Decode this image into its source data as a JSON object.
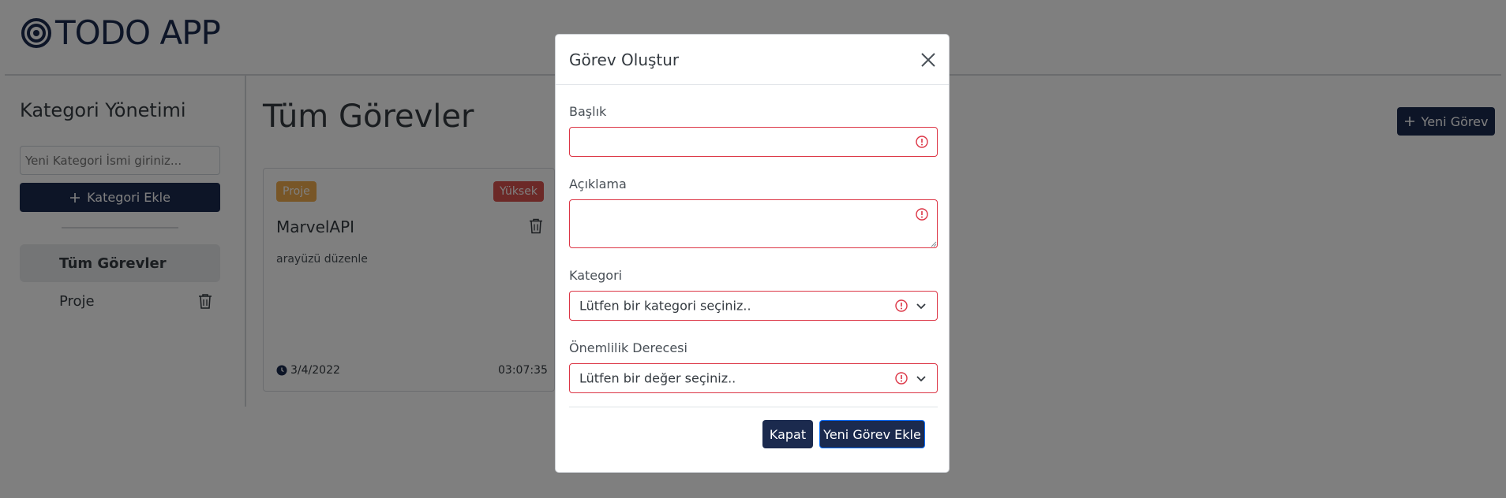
{
  "app": {
    "logo_text": "TODO APP"
  },
  "sidebar": {
    "title": "Kategori Yönetimi",
    "category_input_placeholder": "Yeni Kategori İsmi giriniz...",
    "add_category_label": "Kategori Ekle",
    "items": [
      {
        "label": "Tüm Görevler"
      },
      {
        "label": "Proje"
      }
    ]
  },
  "main": {
    "title": "Tüm Görevler",
    "new_task_label": "Yeni Görev",
    "card": {
      "category_badge": "Proje",
      "priority_badge": "Yüksek",
      "title": "MarvelAPI",
      "description": "arayüzü düzenle",
      "date": "3/4/2022",
      "time": "03:07:35"
    }
  },
  "modal": {
    "title": "Görev Oluştur",
    "title_label": "Başlık",
    "description_label": "Açıklama",
    "category_label": "Kategori",
    "category_placeholder": "Lütfen bir kategori seçiniz..",
    "priority_label": "Önemlilik Derecesi",
    "priority_placeholder": "Lütfen bir değer seçiniz..",
    "close_button": "Kapat",
    "submit_button": "Yeni Görev Ekle"
  },
  "colors": {
    "primary": "#1b2a4e",
    "danger": "#dc3545",
    "badge_category": "#f0ad4e",
    "badge_priority": "#d9534f"
  }
}
